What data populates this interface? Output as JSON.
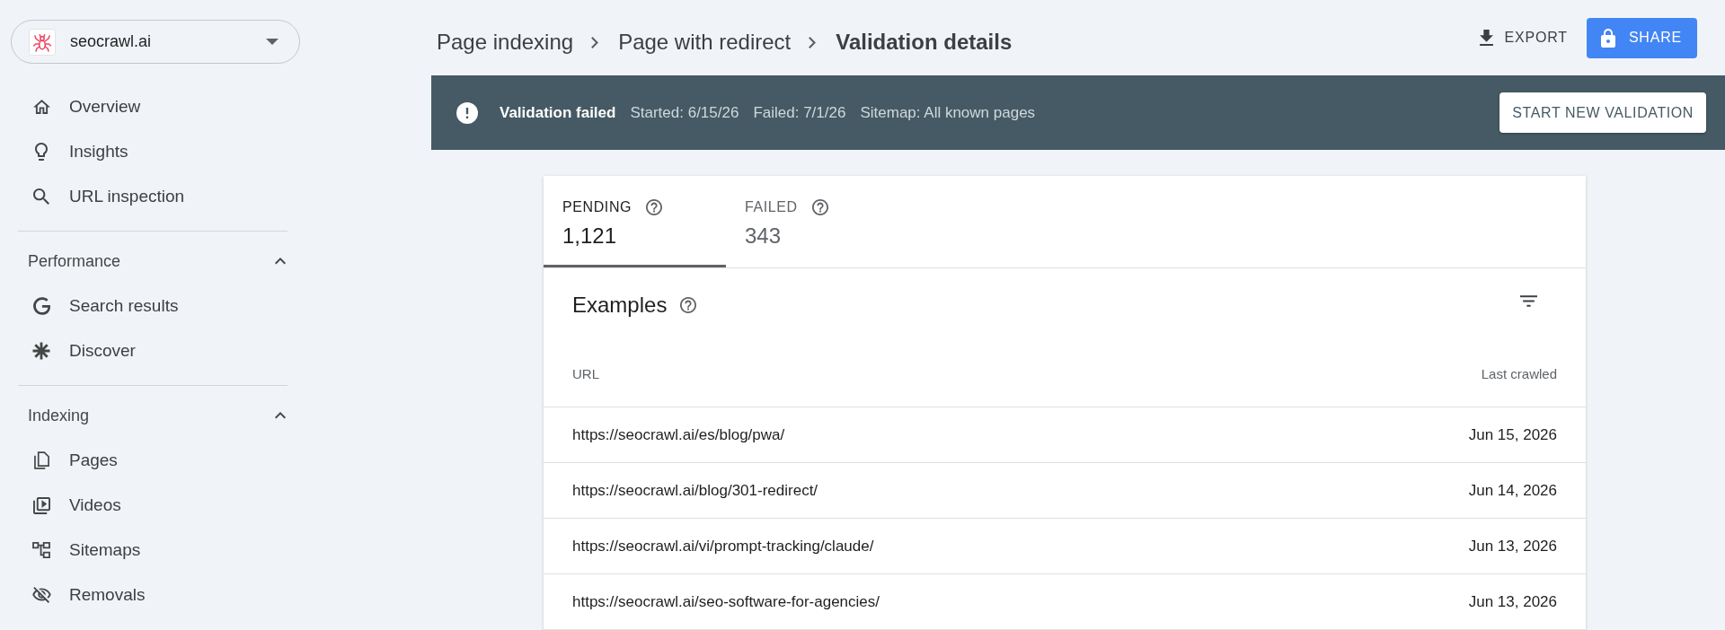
{
  "sidebar": {
    "property_selector": "seocrawl.ai",
    "items": [
      {
        "label": "Overview",
        "selected": false
      },
      {
        "label": "Insights",
        "selected": false
      },
      {
        "label": "URL inspection",
        "selected": false
      }
    ],
    "sections": [
      {
        "title": "Performance",
        "expanded": true,
        "items": [
          {
            "label": "Search results",
            "selected": false
          },
          {
            "label": "Discover",
            "selected": false
          }
        ]
      },
      {
        "title": "Indexing",
        "expanded": true,
        "items": [
          {
            "label": "Pages",
            "selected": false
          },
          {
            "label": "Videos",
            "selected": false
          },
          {
            "label": "Sitemaps",
            "selected": false
          },
          {
            "label": "Removals",
            "selected": false
          }
        ]
      }
    ]
  },
  "breadcrumb": [
    {
      "label": "Page indexing",
      "current": false
    },
    {
      "label": "Page with redirect",
      "current": false
    },
    {
      "label": "Validation details",
      "current": true
    }
  ],
  "toolbar": {
    "export_button": "EXPORT",
    "share_button": "SHARE"
  },
  "validation_banner": {
    "status": "Validation failed",
    "details": [
      "Started: 6/15/26",
      "Failed: 7/1/26",
      "Sitemap: All known pages"
    ],
    "action_button": "START NEW VALIDATION"
  },
  "tabs": [
    {
      "label": "PENDING",
      "count": "1,121",
      "selected": true
    },
    {
      "label": "FAILED",
      "count": "343",
      "selected": false
    }
  ],
  "examples": {
    "title": "Examples",
    "table": {
      "columns": [
        "URL",
        "Last crawled"
      ],
      "rows": [
        [
          "https://seocrawl.ai/es/blog/pwa/",
          "Jun 15, 2026"
        ],
        [
          "https://seocrawl.ai/blog/301-redirect/",
          "Jun 14, 2026"
        ],
        [
          "https://seocrawl.ai/vi/prompt-tracking/claude/",
          "Jun 13, 2026"
        ],
        [
          "https://seocrawl.ai/seo-software-for-agencies/",
          "Jun 13, 2026"
        ]
      ]
    }
  }
}
